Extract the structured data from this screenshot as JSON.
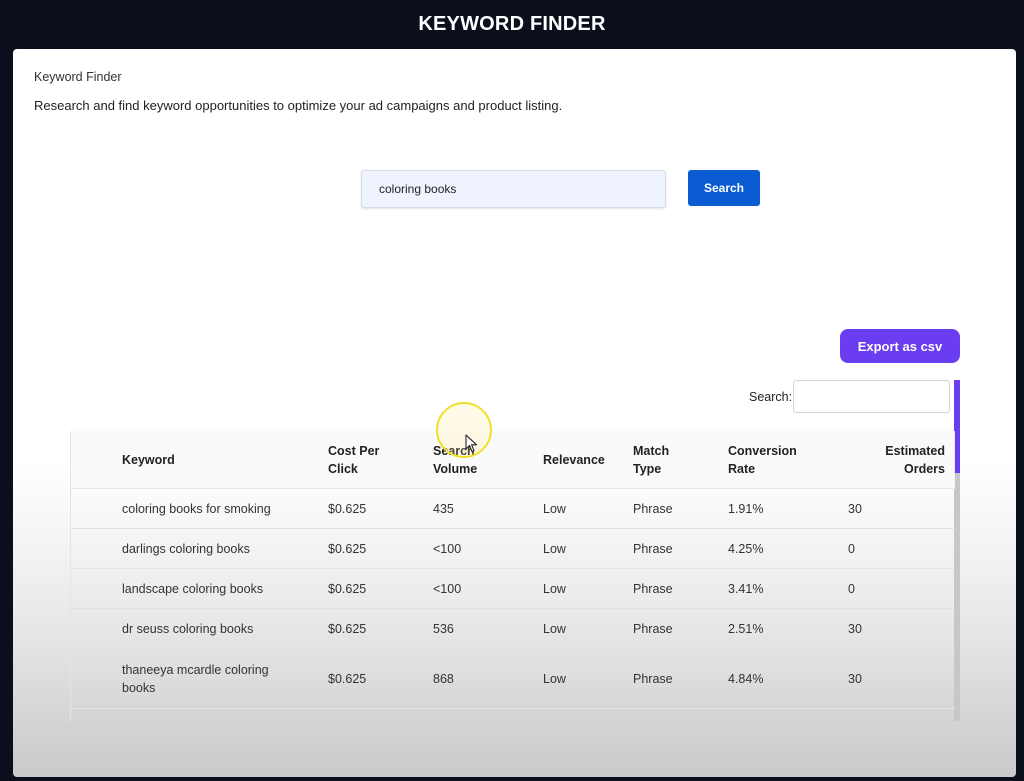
{
  "app": {
    "title": "KEYWORD FINDER"
  },
  "page": {
    "breadcrumb": "Keyword Finder",
    "description": "Research and find keyword opportunities to optimize your ad campaigns and product listing."
  },
  "search": {
    "value": "coloring books",
    "button_label": "Search"
  },
  "export": {
    "button_label": "Export as csv"
  },
  "table_filter": {
    "label": "Search:",
    "value": ""
  },
  "table": {
    "headers": {
      "keyword": "Keyword",
      "cpc_1": "Cost Per",
      "cpc_2": "Click",
      "volume_1": "Search",
      "volume_2": "Volume",
      "relevance": "Relevance",
      "match_1": "Match",
      "match_2": "Type",
      "conv_1": "Conversion",
      "conv_2": "Rate",
      "orders_1": "Estimated",
      "orders_2": "Orders"
    },
    "rows": [
      {
        "keyword": "coloring books for smoking",
        "cpc": "$0.625",
        "volume": "435",
        "relevance": "Low",
        "match": "Phrase",
        "conversion": "1.91%",
        "orders": "30"
      },
      {
        "keyword": "darlings coloring books",
        "cpc": "$0.625",
        "volume": "<100",
        "relevance": "Low",
        "match": "Phrase",
        "conversion": "4.25%",
        "orders": "0"
      },
      {
        "keyword": "landscape coloring books",
        "cpc": "$0.625",
        "volume": "<100",
        "relevance": "Low",
        "match": "Phrase",
        "conversion": "3.41%",
        "orders": "0"
      },
      {
        "keyword": "dr seuss coloring books",
        "cpc": "$0.625",
        "volume": "536",
        "relevance": "Low",
        "match": "Phrase",
        "conversion": "2.51%",
        "orders": "30"
      },
      {
        "keyword_1": "thaneeya mcardle coloring",
        "keyword_2": "books",
        "cpc": "$0.625",
        "volume": "868",
        "relevance": "Low",
        "match": "Phrase",
        "conversion": "4.84%",
        "orders": "30"
      }
    ]
  },
  "colors": {
    "primary": "#0b5bd3",
    "accent": "#6a3df0",
    "topbar": "#0b0f1c"
  },
  "icons": {
    "cursor": "cursor-icon"
  }
}
